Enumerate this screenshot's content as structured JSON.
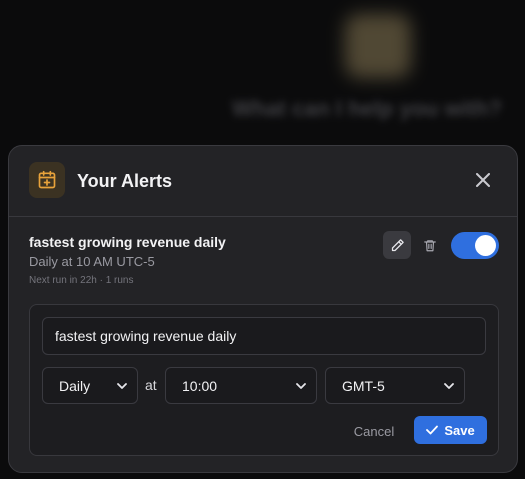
{
  "background": {
    "blurred_text": "What can I help you with?"
  },
  "modal": {
    "title": "Your Alerts",
    "header_icon": "calendar-plus-icon",
    "close_icon": "close-icon"
  },
  "alert": {
    "name": "fastest growing revenue daily",
    "schedule": "Daily at 10 AM UTC-5",
    "next_run": "Next run in 22h · 1 runs",
    "enabled": true
  },
  "edit_form": {
    "name_value": "fastest growing revenue daily",
    "frequency": "Daily",
    "at_label": "at",
    "time": "10:00",
    "timezone": "GMT-5",
    "cancel_label": "Cancel",
    "save_label": "Save"
  },
  "colors": {
    "accent": "#2f6fdf",
    "icon_accent": "#e8a33b",
    "modal_bg": "#232326"
  }
}
